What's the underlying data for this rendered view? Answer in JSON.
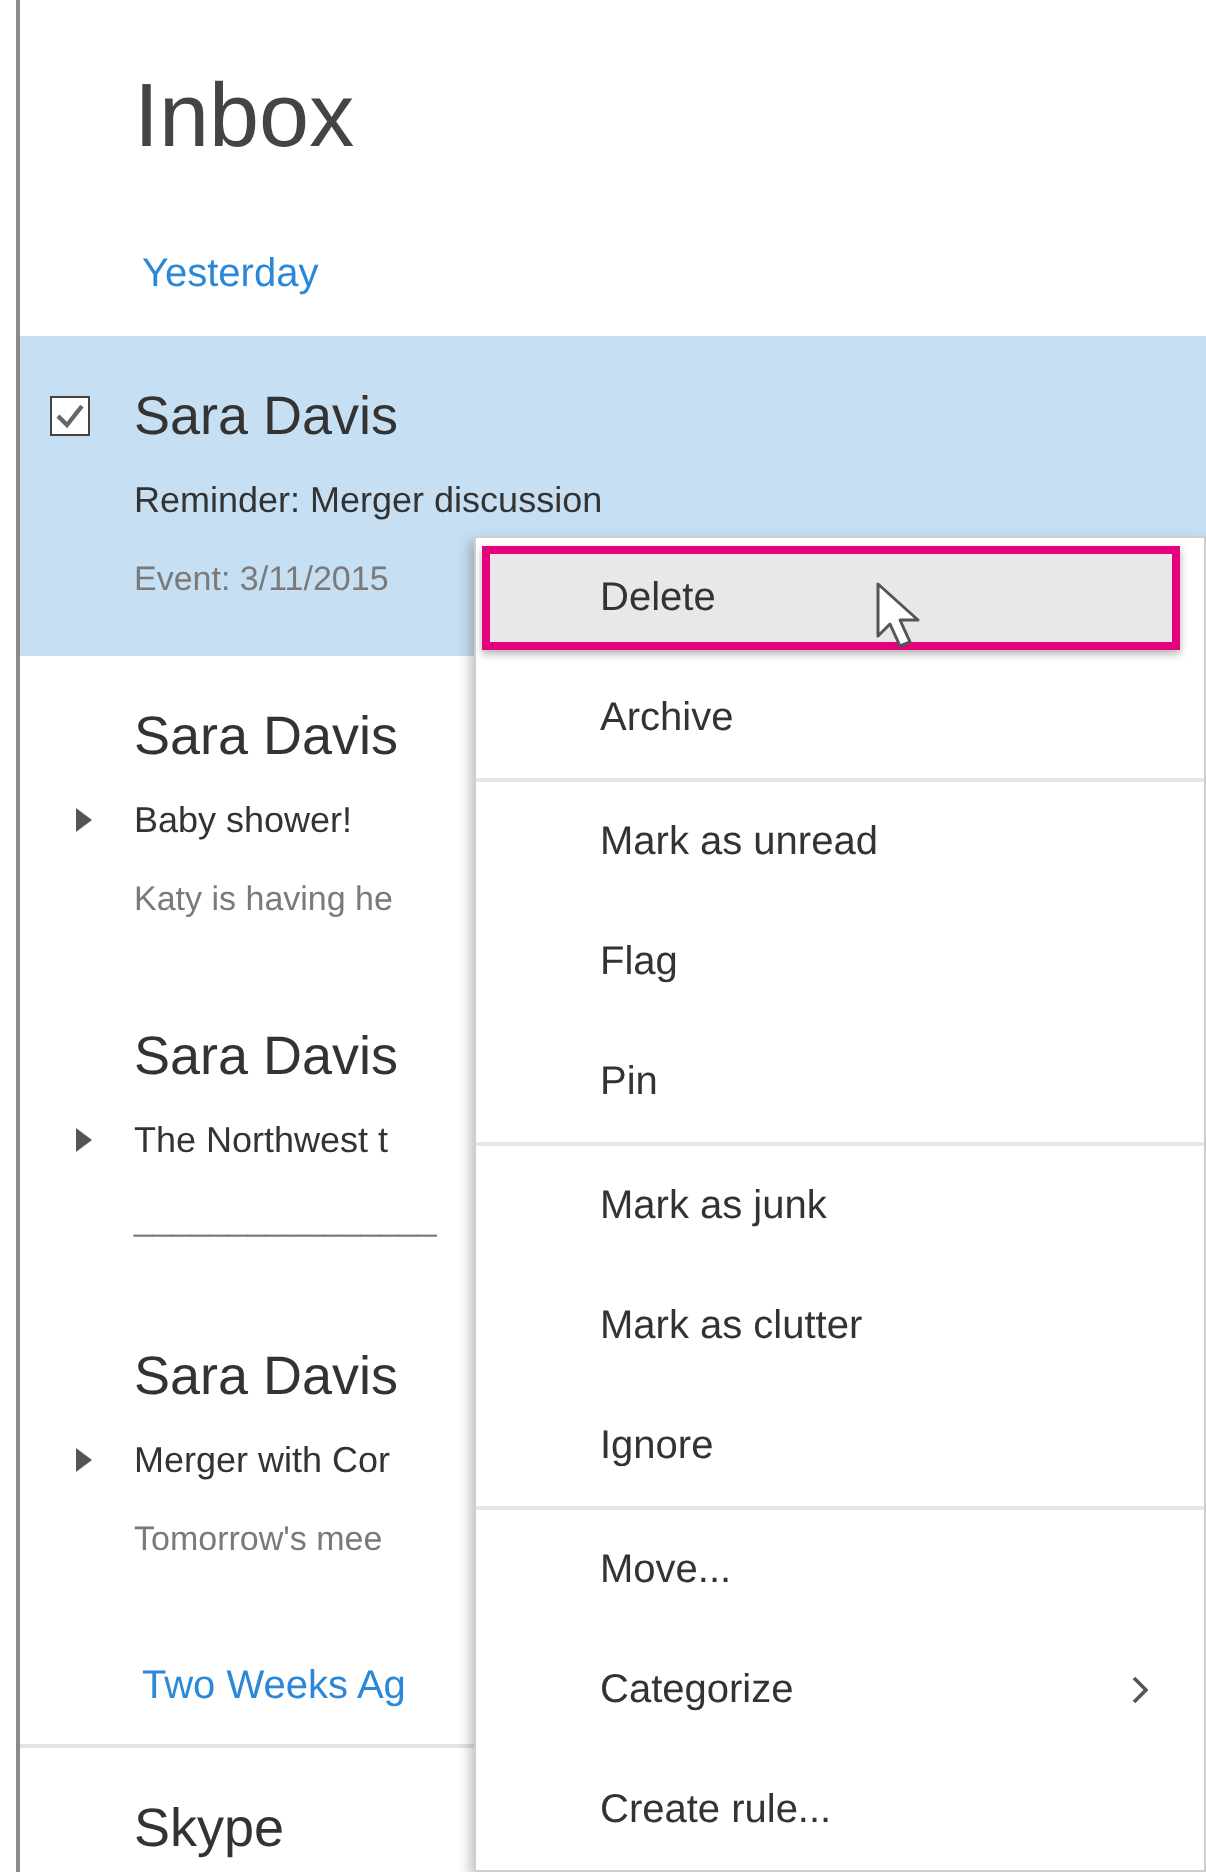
{
  "title": "Inbox",
  "groups": [
    {
      "label": "Yesterday",
      "messages": [
        {
          "sender": "Sara Davis",
          "subject": "Reminder: Merger discussion",
          "preview": "Event: 3/11/2015",
          "selected": true,
          "checked": true,
          "thread": false
        },
        {
          "sender": "Sara Davis",
          "subject": "Baby shower!",
          "preview": "Katy is having he",
          "selected": false,
          "checked": false,
          "thread": true
        },
        {
          "sender": "Sara Davis",
          "subject": "The Northwest t",
          "preview": "________________",
          "selected": false,
          "checked": false,
          "thread": true
        },
        {
          "sender": "Sara Davis",
          "subject": "Merger with Cor",
          "preview": "Tomorrow's mee",
          "selected": false,
          "checked": false,
          "thread": true
        }
      ]
    },
    {
      "label": "Two Weeks Ag",
      "messages": [
        {
          "sender": "Skype",
          "selected": false,
          "checked": false,
          "thread": false
        }
      ]
    }
  ],
  "context_menu": {
    "sections": [
      [
        {
          "label": "Delete",
          "selected": true,
          "submenu": false
        },
        {
          "label": "Archive",
          "selected": false,
          "submenu": false
        }
      ],
      [
        {
          "label": "Mark as unread",
          "selected": false,
          "submenu": false
        },
        {
          "label": "Flag",
          "selected": false,
          "submenu": false
        },
        {
          "label": "Pin",
          "selected": false,
          "submenu": false
        }
      ],
      [
        {
          "label": "Mark as junk",
          "selected": false,
          "submenu": false
        },
        {
          "label": "Mark as clutter",
          "selected": false,
          "submenu": false
        },
        {
          "label": "Ignore",
          "selected": false,
          "submenu": false
        }
      ],
      [
        {
          "label": "Move...",
          "selected": false,
          "submenu": false
        },
        {
          "label": "Categorize",
          "selected": false,
          "submenu": true
        },
        {
          "label": "Create rule...",
          "selected": false,
          "submenu": false
        }
      ]
    ]
  }
}
